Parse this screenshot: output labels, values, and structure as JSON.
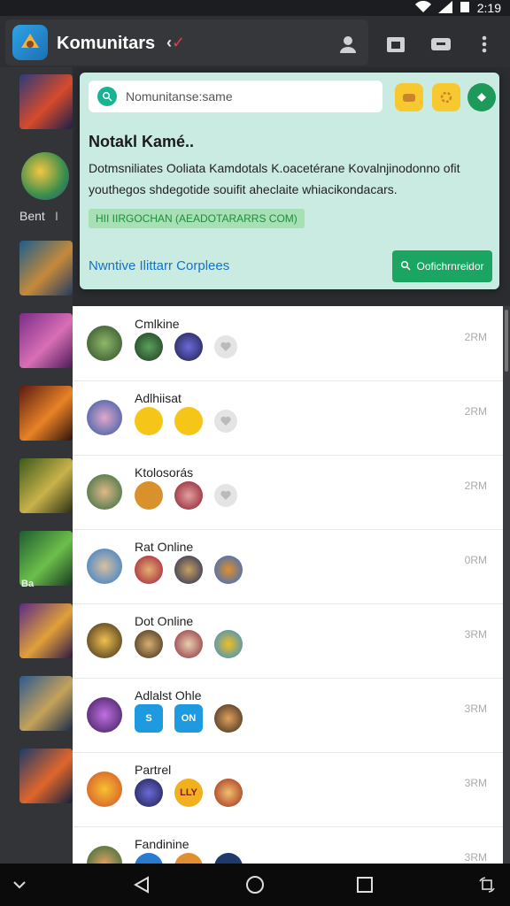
{
  "status": {
    "time": "2:19"
  },
  "app": {
    "title": "Komunitars",
    "title_suffix": "‹",
    "title_check": "✓"
  },
  "sidebar": {
    "label": "Bent",
    "label2": "I",
    "badge": "Ba"
  },
  "card": {
    "search_placeholder": "Nomunitanse:same",
    "title": "Notakl Kamé..",
    "desc": "Dotmsniliates Ooliata Kamdotals K.oacetérane Kovalnjinodonno ofit youthegos shdegotide souifit aheclaite whiacikondacars.",
    "link": "HII IIRGOCHAN (AEADOTARARRS COM)",
    "footer": "Nwntive Ilittarr Corplees",
    "action": "Oofichrnreidor"
  },
  "rows": [
    {
      "name": "Cmlkine",
      "time": "2RM"
    },
    {
      "name": "Adlhiisat",
      "time": "2RM"
    },
    {
      "name": "Ktolosorás",
      "time": "2RM"
    },
    {
      "name": "Rat Online",
      "time": "0RM"
    },
    {
      "name": "Dot Online",
      "time": "3RM"
    },
    {
      "name": "Adlalst Ohle",
      "time": "3RM"
    },
    {
      "name": "Partrel",
      "time": "3RM"
    },
    {
      "name": "Fandinine",
      "time": "3RM"
    }
  ],
  "mini_labels": {
    "blue1": "S",
    "blue2": "ON",
    "gold": "LLY"
  },
  "colors": {
    "accent": "#1aa563",
    "card_bg": "#c9ebe2",
    "link": "#1573c4"
  }
}
